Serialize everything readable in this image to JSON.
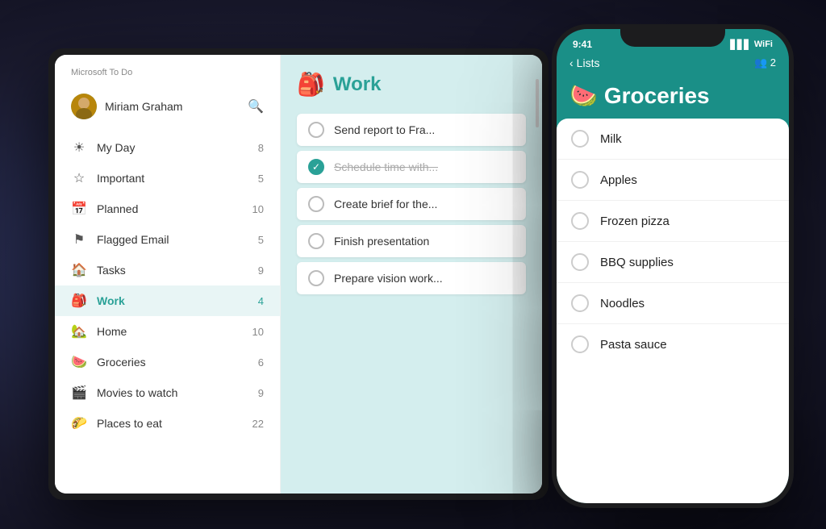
{
  "app": {
    "name": "Microsoft To Do"
  },
  "tablet": {
    "sidebar": {
      "title": "Microsoft To Do",
      "user": {
        "name": "Miriam Graham"
      },
      "nav_items": [
        {
          "id": "my-day",
          "icon": "☀",
          "label": "My Day",
          "count": "8",
          "active": false
        },
        {
          "id": "important",
          "icon": "☆",
          "label": "Important",
          "count": "5",
          "active": false
        },
        {
          "id": "planned",
          "icon": "📅",
          "label": "Planned",
          "count": "10",
          "active": false
        },
        {
          "id": "flagged-email",
          "icon": "⚑",
          "label": "Flagged Email",
          "count": "5",
          "active": false
        },
        {
          "id": "tasks",
          "icon": "🏠",
          "label": "Tasks",
          "count": "9",
          "active": false
        },
        {
          "id": "work",
          "icon": "🎒",
          "label": "Work",
          "count": "4",
          "active": true
        },
        {
          "id": "home",
          "icon": "🏡",
          "label": "Home",
          "count": "10",
          "active": false
        },
        {
          "id": "groceries",
          "icon": "🍉",
          "label": "Groceries",
          "count": "6",
          "active": false
        },
        {
          "id": "movies-to-watch",
          "icon": "🎬",
          "label": "Movies to watch",
          "count": "9",
          "active": false
        },
        {
          "id": "places-to-eat",
          "icon": "🌮",
          "label": "Places to eat",
          "count": "22",
          "active": false
        }
      ]
    },
    "main": {
      "list_title": "Work",
      "list_icon": "🎒",
      "tasks": [
        {
          "id": 1,
          "text": "Send report to Fra...",
          "completed": false
        },
        {
          "id": 2,
          "text": "Schedule time with...",
          "completed": true
        },
        {
          "id": 3,
          "text": "Create brief for the...",
          "completed": false
        },
        {
          "id": 4,
          "text": "Finish presentation",
          "completed": false
        },
        {
          "id": 5,
          "text": "Prepare vision work...",
          "completed": false
        }
      ]
    }
  },
  "phone": {
    "status_bar": {
      "time": "9:41",
      "signal": "▋▋▋",
      "wifi": "WiFi"
    },
    "nav": {
      "back_label": "Lists",
      "action_label": "👥 2"
    },
    "list_title": "Groceries",
    "list_icon": "🍉",
    "items": [
      {
        "id": 1,
        "text": "Milk"
      },
      {
        "id": 2,
        "text": "Apples"
      },
      {
        "id": 3,
        "text": "Frozen pizza"
      },
      {
        "id": 4,
        "text": "BBQ supplies"
      },
      {
        "id": 5,
        "text": "Noodles"
      },
      {
        "id": 6,
        "text": "Pasta sauce"
      }
    ]
  }
}
